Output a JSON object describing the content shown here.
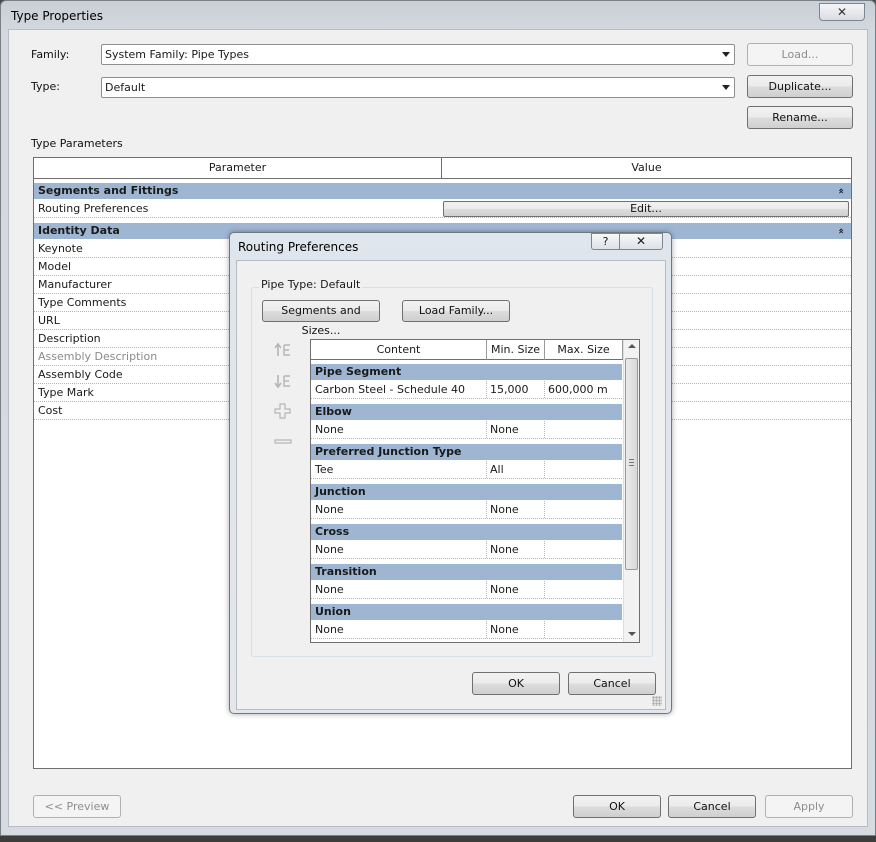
{
  "window": {
    "title": "Type Properties",
    "close_glyph": "✕"
  },
  "family": {
    "label": "Family:",
    "value": "System Family: Pipe Types",
    "load_button": "Load..."
  },
  "type": {
    "label": "Type:",
    "value": "Default",
    "duplicate_button": "Duplicate...",
    "rename_button": "Rename..."
  },
  "type_parameters": {
    "label": "Type Parameters",
    "columns": [
      "Parameter",
      "Value"
    ],
    "groups": [
      {
        "name": "Segments and Fittings",
        "rows": [
          {
            "name": "Routing Preferences",
            "value": "Edit..."
          }
        ]
      },
      {
        "name": "Identity Data",
        "rows": [
          {
            "name": "Keynote"
          },
          {
            "name": "Model"
          },
          {
            "name": "Manufacturer"
          },
          {
            "name": "Type Comments"
          },
          {
            "name": "URL"
          },
          {
            "name": "Description"
          },
          {
            "name": "Assembly Description"
          },
          {
            "name": "Assembly Code"
          },
          {
            "name": "Type Mark"
          },
          {
            "name": "Cost"
          }
        ]
      }
    ],
    "collapse_glyph": "»"
  },
  "footer": {
    "preview": "<< Preview",
    "ok": "OK",
    "cancel": "Cancel",
    "apply": "Apply"
  },
  "routing_dialog": {
    "title": "Routing Preferences",
    "help_glyph": "?",
    "close_glyph": "✕",
    "pipe_type": "Pipe Type: Default",
    "segments_button": "Segments and Sizes...",
    "load_family_button": "Load Family...",
    "columns": [
      "Content",
      "Min. Size",
      "Max. Size"
    ],
    "groups": [
      {
        "name": "Pipe Segment",
        "content": "Carbon Steel - Schedule 40",
        "min": "15,000",
        "max": "600,000 m"
      },
      {
        "name": "Elbow",
        "content": "None",
        "min": "None",
        "max": ""
      },
      {
        "name": "Preferred Junction Type",
        "content": "Tee",
        "min": "All",
        "max": ""
      },
      {
        "name": "Junction",
        "content": "None",
        "min": "None",
        "max": ""
      },
      {
        "name": "Cross",
        "content": "None",
        "min": "None",
        "max": ""
      },
      {
        "name": "Transition",
        "content": "None",
        "min": "None",
        "max": ""
      },
      {
        "name": "Union",
        "content": "None",
        "min": "None",
        "max": ""
      }
    ],
    "ok": "OK",
    "cancel": "Cancel"
  },
  "colors": {
    "group_header": "#9fb6d3",
    "dialog_bg": "#f0f0f0"
  }
}
